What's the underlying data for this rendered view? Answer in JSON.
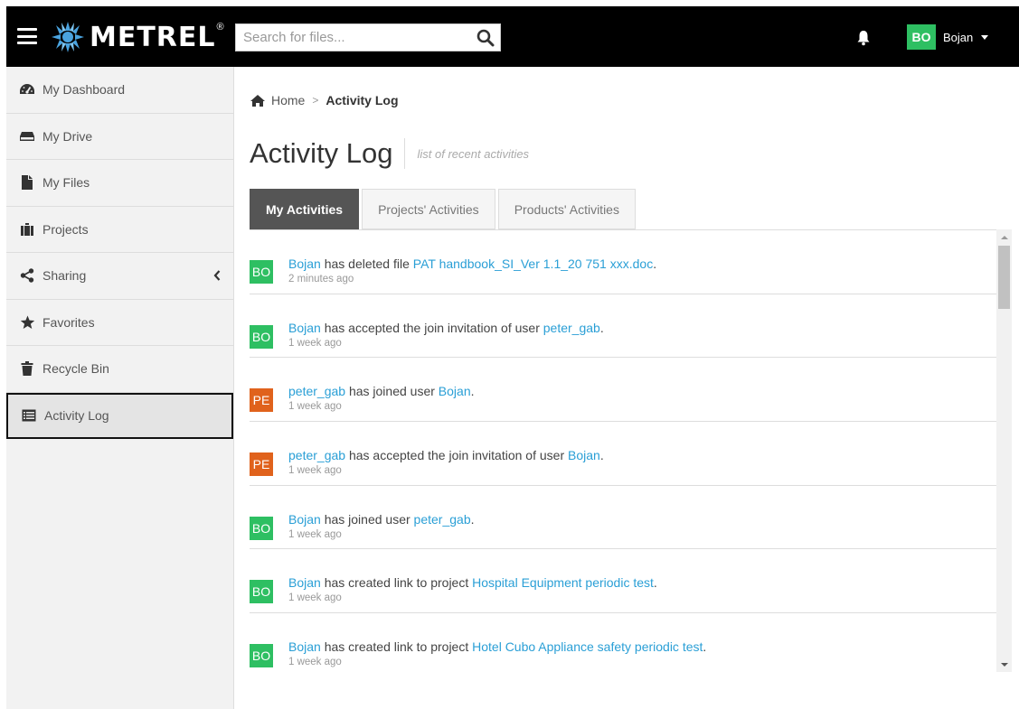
{
  "header": {
    "logo_text": "METREL",
    "logo_mark": "®",
    "search": {
      "placeholder": "Search for files..."
    },
    "user": {
      "initials": "BO",
      "name": "Bojan"
    }
  },
  "sidebar": {
    "items": [
      {
        "label": "My Dashboard",
        "icon": "dashboard-icon"
      },
      {
        "label": "My Drive",
        "icon": "drive-icon"
      },
      {
        "label": "My Files",
        "icon": "file-icon"
      },
      {
        "label": "Projects",
        "icon": "suitcase-icon"
      },
      {
        "label": "Sharing",
        "icon": "share-icon"
      },
      {
        "label": "Favorites",
        "icon": "star-icon"
      },
      {
        "label": "Recycle Bin",
        "icon": "trash-icon"
      },
      {
        "label": "Activity Log",
        "icon": "list-icon",
        "active": true
      }
    ]
  },
  "breadcrumb": {
    "home": "Home",
    "current": "Activity Log"
  },
  "page": {
    "title": "Activity Log",
    "subtitle": "list of recent activities"
  },
  "tabs": [
    {
      "label": "My Activities",
      "active": true
    },
    {
      "label": "Projects' Activities"
    },
    {
      "label": "Products' Activities"
    }
  ],
  "colors": {
    "green": "#2ebf62",
    "orange": "#e0621c",
    "link": "#2a9fd6"
  },
  "activities": [
    {
      "initials": "BO",
      "color": "green",
      "actor": "Bojan",
      "text": " has deleted file ",
      "target": "PAT handbook_SI_Ver 1.1_20 751 xxx.doc",
      "end": ".",
      "time": "2 minutes ago"
    },
    {
      "initials": "BO",
      "color": "green",
      "actor": "Bojan",
      "text": " has accepted the join invitation of user ",
      "target": "peter_gab",
      "end": ".",
      "time": "1 week ago"
    },
    {
      "initials": "PE",
      "color": "orange",
      "actor": "peter_gab",
      "text": " has joined user ",
      "target": "Bojan",
      "end": ".",
      "time": "1 week ago"
    },
    {
      "initials": "PE",
      "color": "orange",
      "actor": "peter_gab",
      "text": " has accepted the join invitation of user ",
      "target": "Bojan",
      "end": ".",
      "time": "1 week ago"
    },
    {
      "initials": "BO",
      "color": "green",
      "actor": "Bojan",
      "text": " has joined user ",
      "target": "peter_gab",
      "end": ".",
      "time": "1 week ago"
    },
    {
      "initials": "BO",
      "color": "green",
      "actor": "Bojan",
      "text": " has created link to project ",
      "target": "Hospital Equipment periodic test",
      "end": ".",
      "time": "1 week ago"
    },
    {
      "initials": "BO",
      "color": "green",
      "actor": "Bojan",
      "text": " has created link to project ",
      "target": "Hotel Cubo Appliance safety periodic test",
      "end": ".",
      "time": "1 week ago"
    }
  ]
}
